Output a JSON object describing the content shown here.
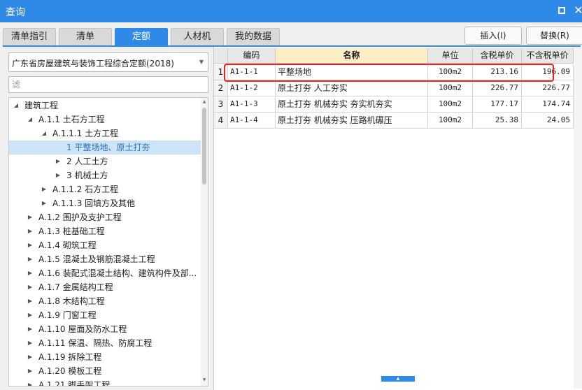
{
  "window": {
    "title": "查询"
  },
  "tabs": [
    {
      "label": "清单指引",
      "active": false
    },
    {
      "label": "清单",
      "active": false
    },
    {
      "label": "定额",
      "active": true
    },
    {
      "label": "人材机",
      "active": false
    },
    {
      "label": "我的数据",
      "active": false
    }
  ],
  "actions": {
    "insert_label": "插入(I)",
    "replace_label": "替换(R)"
  },
  "library": {
    "selected": "广东省房屋建筑与装饰工程综合定额(2018)"
  },
  "filter": {
    "placeholder": "滤",
    "value": ""
  },
  "tree": [
    {
      "label": "建筑工程",
      "expanded": true,
      "selected": false
    },
    {
      "label": "A.1.1 土石方工程",
      "expanded": true,
      "selected": false
    },
    {
      "label": "A.1.1.1 土方工程",
      "expanded": true,
      "selected": false
    },
    {
      "label": "1 平整场地、原土打夯",
      "expanded": null,
      "selected": true
    },
    {
      "label": "2 人工土方",
      "expanded": false,
      "selected": false
    },
    {
      "label": "3 机械土方",
      "expanded": false,
      "selected": false
    },
    {
      "label": "A.1.1.2 石方工程",
      "expanded": false,
      "selected": false
    },
    {
      "label": "A.1.1.3 回填方及其他",
      "expanded": false,
      "selected": false
    },
    {
      "label": "A.1.2 围护及支护工程",
      "expanded": false,
      "selected": false
    },
    {
      "label": "A.1.3 桩基础工程",
      "expanded": false,
      "selected": false
    },
    {
      "label": "A.1.4 砌筑工程",
      "expanded": false,
      "selected": false
    },
    {
      "label": "A.1.5 混凝土及钢筋混凝土工程",
      "expanded": false,
      "selected": false
    },
    {
      "label": "A.1.6 装配式混凝土结构、建筑构件及部...",
      "expanded": false,
      "selected": false
    },
    {
      "label": "A.1.7 金属结构工程",
      "expanded": false,
      "selected": false
    },
    {
      "label": "A.1.8 木结构工程",
      "expanded": false,
      "selected": false
    },
    {
      "label": "A.1.9 门窗工程",
      "expanded": false,
      "selected": false
    },
    {
      "label": "A.1.10 屋面及防水工程",
      "expanded": false,
      "selected": false
    },
    {
      "label": "A.1.11 保温、隔热、防腐工程",
      "expanded": false,
      "selected": false
    },
    {
      "label": "A.1.19 拆除工程",
      "expanded": false,
      "selected": false
    },
    {
      "label": "A.1.20 模板工程",
      "expanded": false,
      "selected": false
    },
    {
      "label": "A.1.21 脚手架工程",
      "expanded": false,
      "selected": false
    }
  ],
  "grid": {
    "columns": [
      "编码",
      "名称",
      "单位",
      "含税单价",
      "不含税单价"
    ],
    "rows": [
      {
        "idx": "1",
        "code": "A1-1-1",
        "name": "平整场地",
        "unit": "100m2",
        "price_tax": "213.16",
        "price_notax": "196.09",
        "highlighted": true
      },
      {
        "idx": "2",
        "code": "A1-1-2",
        "name": "原土打夯 人工夯实",
        "unit": "100m2",
        "price_tax": "226.77",
        "price_notax": "226.77",
        "highlighted": false
      },
      {
        "idx": "3",
        "code": "A1-1-3",
        "name": "原土打夯 机械夯实 夯实机夯实",
        "unit": "100m2",
        "price_tax": "177.17",
        "price_notax": "174.74",
        "highlighted": false
      },
      {
        "idx": "4",
        "code": "A1-1-4",
        "name": "原土打夯 机械夯实 压路机碾压",
        "unit": "100m2",
        "price_tax": "25.38",
        "price_notax": "24.05",
        "highlighted": false
      }
    ]
  },
  "colors": {
    "accent": "#2e8ae6",
    "highlight": "#e8221d",
    "header_name_bg": "#ffefc6",
    "selection_bg": "#cce4f7"
  }
}
